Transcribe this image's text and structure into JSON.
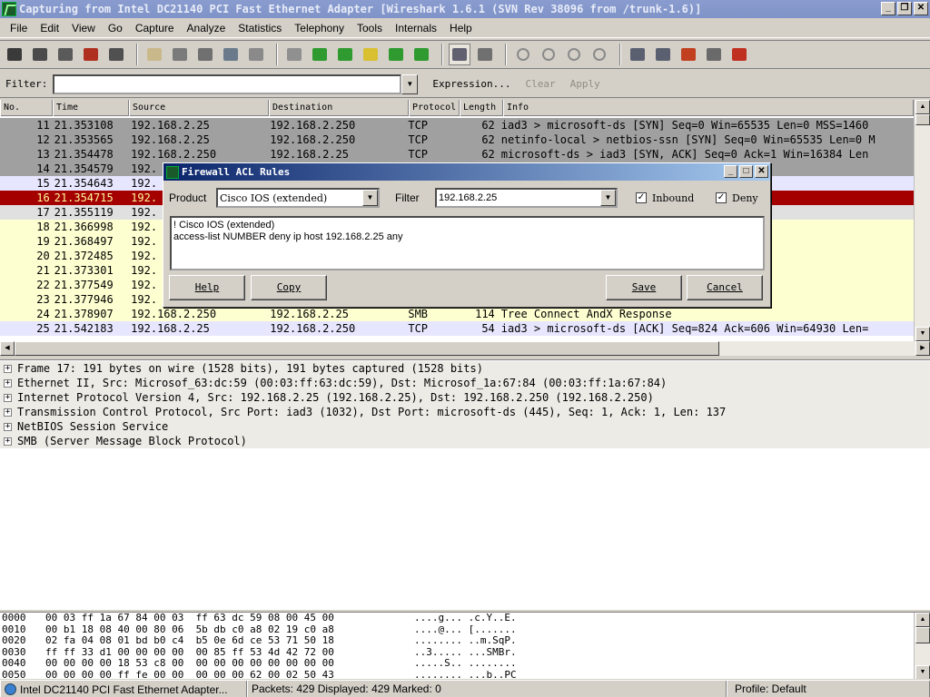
{
  "window": {
    "title": "Capturing from Intel DC21140 PCI Fast Ethernet Adapter   [Wireshark 1.6.1  (SVN Rev 38096 from /trunk-1.6)]",
    "buttons": [
      "_",
      "❐",
      "✕"
    ]
  },
  "menu": [
    "File",
    "Edit",
    "View",
    "Go",
    "Capture",
    "Analyze",
    "Statistics",
    "Telephony",
    "Tools",
    "Internals",
    "Help"
  ],
  "filterbar": {
    "label": "Filter:",
    "value": "",
    "expression": "Expression...",
    "clear": "Clear",
    "apply": "Apply"
  },
  "packet_list": {
    "columns": [
      "No.",
      "Time",
      "Source",
      "Destination",
      "Protocol",
      "Length",
      "Info"
    ],
    "rows": [
      {
        "no": "11",
        "time": "21.353108",
        "src": "192.168.2.25",
        "dst": "192.168.2.250",
        "proto": "TCP",
        "len": "62",
        "info": "iad3 > microsoft-ds [SYN] Seq=0 Win=65535 Len=0 MSS=1460",
        "bg": "#a0a0a0",
        "fg": "#000000"
      },
      {
        "no": "12",
        "time": "21.353565",
        "src": "192.168.2.25",
        "dst": "192.168.2.250",
        "proto": "TCP",
        "len": "62",
        "info": "netinfo-local > netbios-ssn [SYN] Seq=0 Win=65535 Len=0 M",
        "bg": "#a0a0a0",
        "fg": "#000000"
      },
      {
        "no": "13",
        "time": "21.354478",
        "src": "192.168.2.250",
        "dst": "192.168.2.25",
        "proto": "TCP",
        "len": "62",
        "info": "microsoft-ds > iad3 [SYN, ACK] Seq=0 Ack=1 Win=16384 Len",
        "bg": "#a0a0a0",
        "fg": "#000000"
      },
      {
        "no": "14",
        "time": "21.354579",
        "src": "192.",
        "dst": "",
        "proto": "",
        "len": "",
        "info": "] Seq=0 Ack=1 Win=1",
        "bg": "#a0a0a0",
        "fg": "#000000"
      },
      {
        "no": "15",
        "time": "21.354643",
        "src": "192.",
        "dst": "",
        "proto": "",
        "len": "",
        "info": ". Win=65535 Len=0",
        "bg": "#e7e6ff",
        "fg": "#000000"
      },
      {
        "no": "16",
        "time": "21.354715",
        "src": "192.",
        "dst": "",
        "proto": "",
        "len": "",
        "info": "=1 Win=0 Len=0",
        "bg": "#a40000",
        "fg": "#fffc9c"
      },
      {
        "no": "17",
        "time": "21.355119",
        "src": "192.",
        "dst": "",
        "proto": "",
        "len": "",
        "info": "",
        "bg": "#e0e0e0",
        "fg": "#000000"
      },
      {
        "no": "18",
        "time": "21.366998",
        "src": "192.",
        "dst": "",
        "proto": "",
        "len": "",
        "info": "",
        "bg": "#feffd0",
        "fg": "#000000"
      },
      {
        "no": "19",
        "time": "21.368497",
        "src": "192.",
        "dst": "",
        "proto": "",
        "len": "",
        "info": "EGOTIATE",
        "bg": "#feffd0",
        "fg": "#000000"
      },
      {
        "no": "20",
        "time": "21.372485",
        "src": "192.",
        "dst": "",
        "proto": "",
        "len": "",
        "info": "CHALLENGE, Error: ST",
        "bg": "#feffd0",
        "fg": "#000000"
      },
      {
        "no": "21",
        "time": "21.373301",
        "src": "192.",
        "dst": "",
        "proto": "",
        "len": "",
        "info": "AUTH, User: HXW\\admi",
        "bg": "#feffd0",
        "fg": "#000000"
      },
      {
        "no": "22",
        "time": "21.377549",
        "src": "192.",
        "dst": "",
        "proto": "",
        "len": "",
        "info": "",
        "bg": "#feffd0",
        "fg": "#000000"
      },
      {
        "no": "23",
        "time": "21.377946",
        "src": "192.",
        "dst": "",
        "proto": "",
        "len": "",
        "info": "2.168.2.250\\IPC$",
        "bg": "#feffd0",
        "fg": "#000000"
      },
      {
        "no": "24",
        "time": "21.378907",
        "src": "192.168.2.250",
        "dst": "192.168.2.25",
        "proto": "SMB",
        "len": "114",
        "info": "Tree Connect AndX Response",
        "bg": "#feffd0",
        "fg": "#000000"
      },
      {
        "no": "25",
        "time": "21.542183",
        "src": "192.168.2.25",
        "dst": "192.168.2.250",
        "proto": "TCP",
        "len": "54",
        "info": "iad3 > microsoft-ds [ACK] Seq=824 Ack=606 Win=64930 Len=",
        "bg": "#e7e6ff",
        "fg": "#000000"
      }
    ]
  },
  "details": [
    "Frame 17: 191 bytes on wire (1528 bits), 191 bytes captured (1528 bits)",
    "Ethernet II, Src: Microsof_63:dc:59 (00:03:ff:63:dc:59), Dst: Microsof_1a:67:84 (00:03:ff:1a:67:84)",
    "Internet Protocol Version 4, Src: 192.168.2.25 (192.168.2.25), Dst: 192.168.2.250 (192.168.2.250)",
    "Transmission Control Protocol, Src Port: iad3 (1032), Dst Port: microsoft-ds (445), Seq: 1, Ack: 1, Len: 137",
    "NetBIOS Session Service",
    "SMB (Server Message Block Protocol)"
  ],
  "bytes": [
    {
      "off": "0000",
      "hex": "00 03 ff 1a 67 84 00 03  ff 63 dc 59 08 00 45 00",
      "asc": "....g... .c.Y..E."
    },
    {
      "off": "0010",
      "hex": "00 b1 18 08 40 00 80 06  5b db c0 a8 02 19 c0 a8",
      "asc": "....@... [......."
    },
    {
      "off": "0020",
      "hex": "02 fa 04 08 01 bd b0 c4  b5 0e 6d ce 53 71 50 18",
      "asc": "........ ..m.SqP."
    },
    {
      "off": "0030",
      "hex": "ff ff 33 d1 00 00 00 00  00 85 ff 53 4d 42 72 00",
      "asc": "..3..... ...SMBr."
    },
    {
      "off": "0040",
      "hex": "00 00 00 00 18 53 c8 00  00 00 00 00 00 00 00 00",
      "asc": ".....S.. ........"
    },
    {
      "off": "0050",
      "hex": "00 00 00 00 ff fe 00 00  00 00 00 62 00 02 50 43",
      "asc": "........ ...b..PC"
    }
  ],
  "status": {
    "interface": "Intel DC21140 PCI Fast Ethernet Adapter...",
    "packets": "Packets: 429 Displayed: 429 Marked: 0",
    "profile": "Profile: Default"
  },
  "dialog": {
    "title": "Firewall ACL Rules",
    "product_label": "Product",
    "product_value": "Cisco IOS (extended)",
    "filter_label": "Filter",
    "filter_value": "192.168.2.25",
    "inbound_label": "Inbound",
    "deny_label": "Deny",
    "check_mark": "✓",
    "text_line1": "! Cisco IOS (extended)",
    "text_line2": "access-list NUMBER deny ip host 192.168.2.25 any",
    "help": "Help",
    "copy": "Copy",
    "save": "Save",
    "cancel": "Cancel",
    "buttons": [
      "_",
      "□",
      "✕"
    ]
  },
  "toolbar_icons": [
    "interfaces-icon",
    "options-icon",
    "start-capture-icon",
    "stop-capture-icon",
    "restart-capture-icon",
    "open-file-icon",
    "save-file-icon",
    "close-file-icon",
    "reload-icon",
    "print-icon",
    "find-packet-icon",
    "go-back-icon",
    "go-forward-icon",
    "go-to-packet-icon",
    "go-first-icon",
    "go-last-icon",
    "colorize-icon",
    "auto-scroll-icon",
    "zoom-in-icon",
    "zoom-out-icon",
    "zoom-normal-icon",
    "resize-columns-icon",
    "capture-filters-icon",
    "display-filters-icon",
    "coloring-rules-icon",
    "preferences-icon",
    "help-icon"
  ]
}
